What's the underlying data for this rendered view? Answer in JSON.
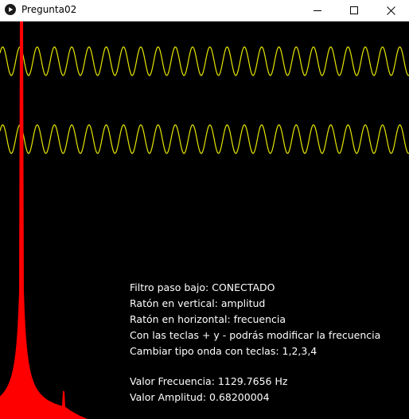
{
  "window": {
    "title": "Pregunta02",
    "controls": {
      "minimize": "minimize-icon",
      "maximize": "maximize-icon",
      "close": "close-icon"
    }
  },
  "colors": {
    "background": "#000000",
    "waveform": "#e6e600",
    "spectrum": "#ff0000",
    "text": "#ffffff"
  },
  "info": {
    "filter": "Filtro paso bajo: CONECTADO",
    "vertical": "Ratón en vertical: amplitud",
    "horizontal": "Ratón en horizontal: frecuencia",
    "keys": "Con las teclas + y - podrás modificar la frecuencia",
    "wave_type": "Cambiar tipo onda con teclas: 1,2,3,4",
    "frequency": "Valor Frecuencia: 1129.7656 Hz",
    "amplitude": "Valor Amplitud: 0.68200004"
  }
}
